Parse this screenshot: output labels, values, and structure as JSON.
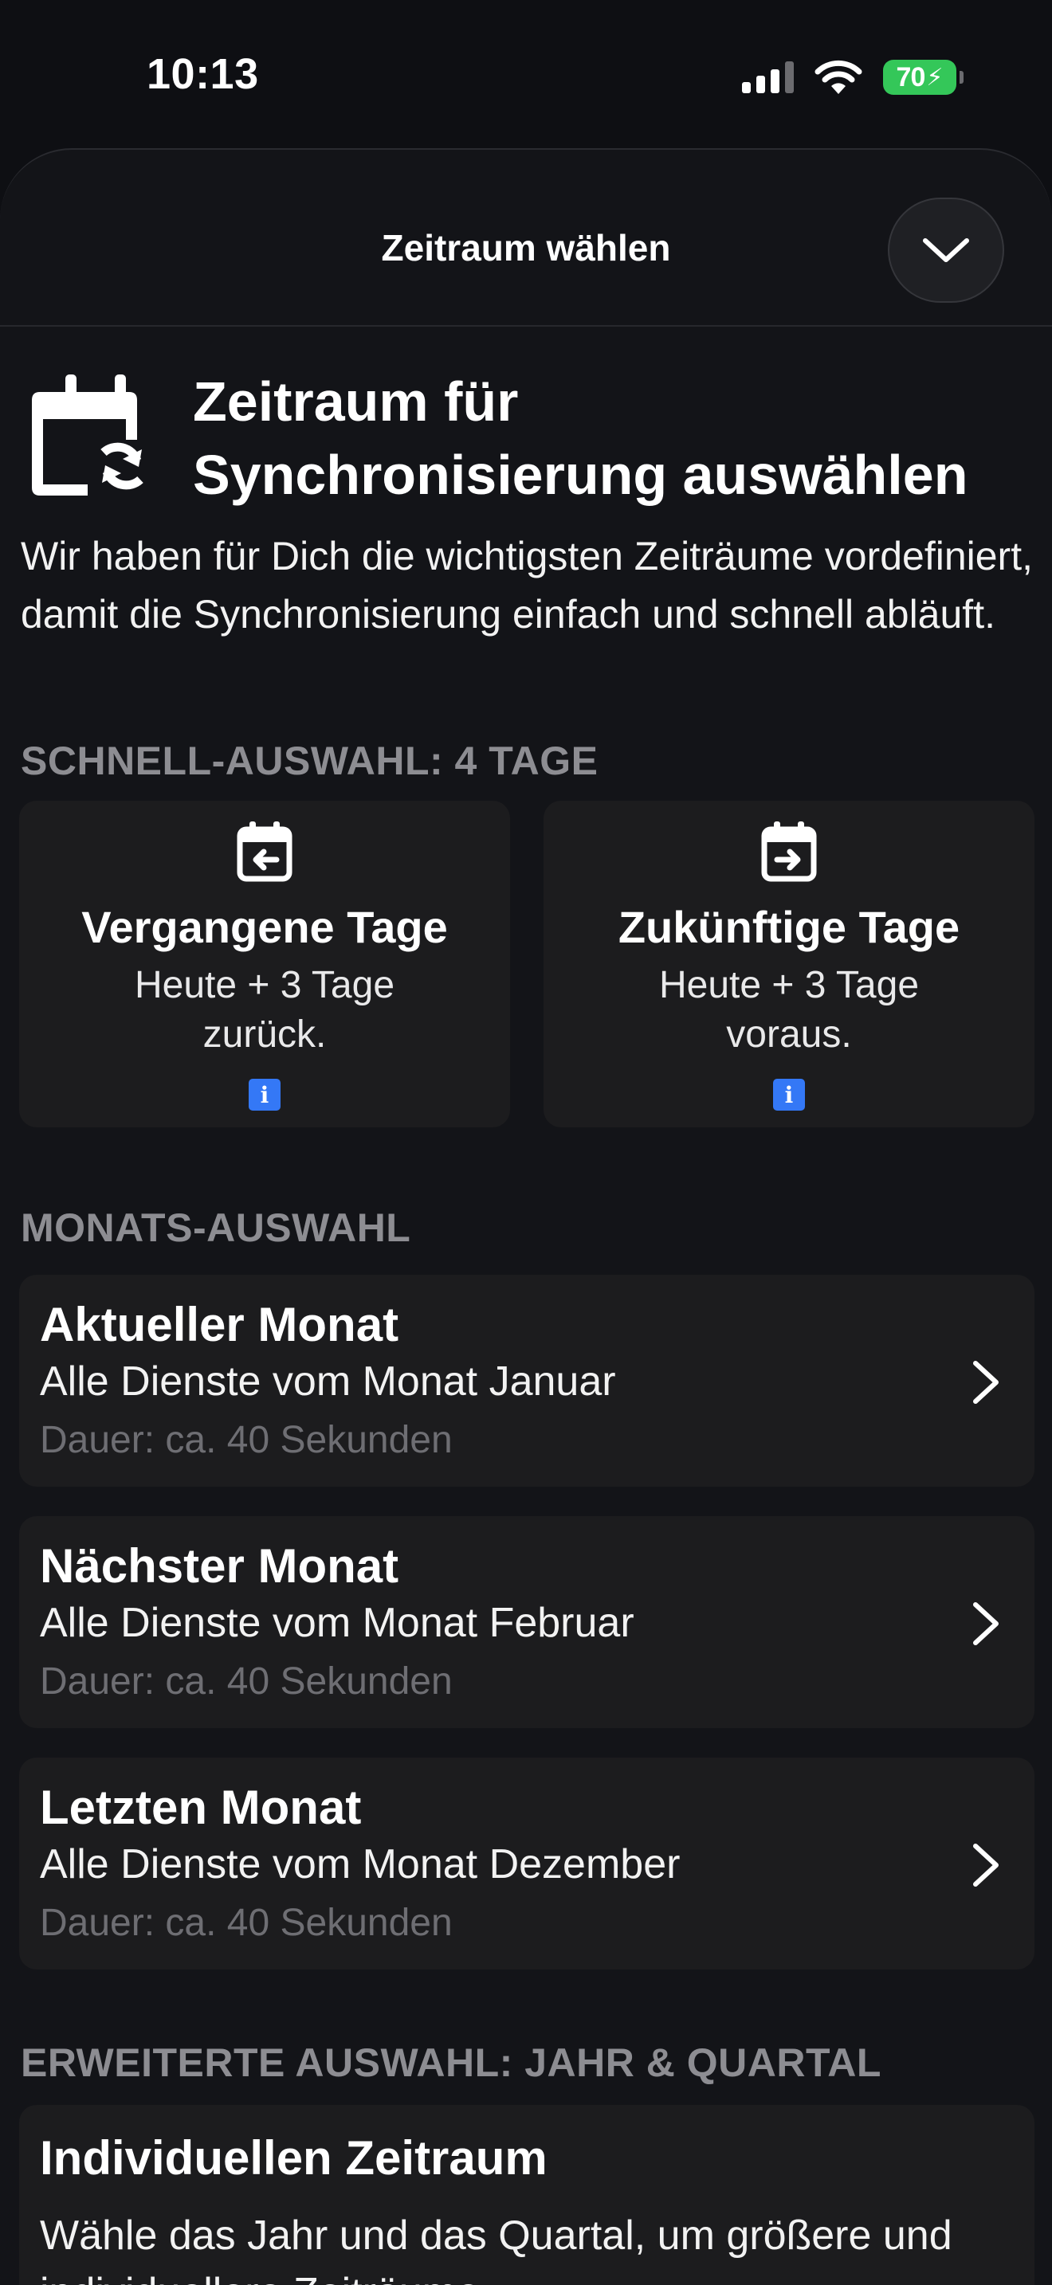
{
  "status_bar": {
    "time": "10:13",
    "battery": "70"
  },
  "sheet": {
    "title": "Zeitraum wählen"
  },
  "intro": {
    "title_line1": "Zeitraum für",
    "title_line2": "Synchronisierung auswählen",
    "description": "Wir haben für Dich die wichtigsten Zeiträume vordefiniert, damit die Synchronisierung einfach und schnell abläuft."
  },
  "quick_select": {
    "label": "SCHNELL-AUSWAHL: 4 TAGE",
    "cards": [
      {
        "title": "Vergangene Tage",
        "subtitle": "Heute + 3 Tage zurück.",
        "info": "i"
      },
      {
        "title": "Zukünftige Tage",
        "subtitle": "Heute + 3 Tage voraus.",
        "info": "i"
      }
    ]
  },
  "month_select": {
    "label": "MONATS-AUSWAHL",
    "items": [
      {
        "title": "Aktueller Monat",
        "subtitle": "Alle Dienste vom Monat Januar",
        "duration": "Dauer: ca. 40 Sekunden"
      },
      {
        "title": "Nächster Monat",
        "subtitle": "Alle Dienste vom Monat Februar",
        "duration": "Dauer: ca. 40 Sekunden"
      },
      {
        "title": "Letzten Monat",
        "subtitle": "Alle Dienste vom Monat Dezember",
        "duration": "Dauer: ca. 40 Sekunden"
      }
    ]
  },
  "extended_select": {
    "label": "ERWEITERTE AUSWAHL: JAHR & QUARTAL",
    "custom": {
      "title": "Individuellen Zeitraum",
      "description": "Wähle das Jahr und das Quartal, um größere und individuellere Zeiträume"
    }
  },
  "colors": {
    "accent": "#3478f6",
    "battery": "#34c759",
    "card": "#1c1c1e",
    "background": "#0e0f13"
  }
}
